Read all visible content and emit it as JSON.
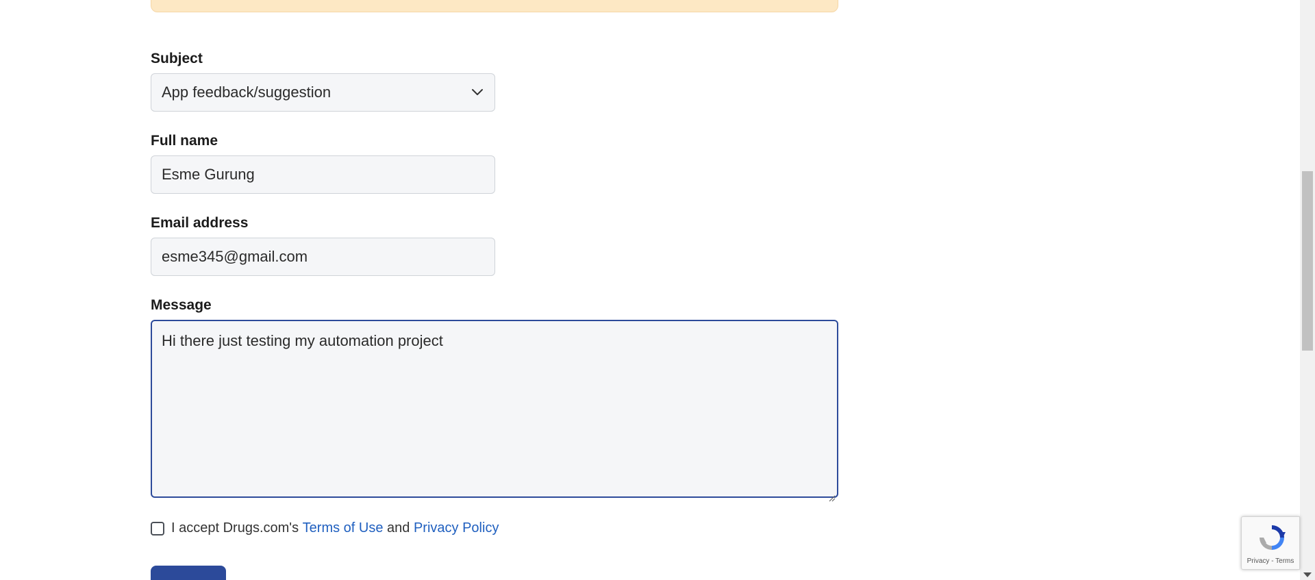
{
  "form": {
    "subject": {
      "label": "Subject",
      "selected": "App feedback/suggestion"
    },
    "full_name": {
      "label": "Full name",
      "value": "Esme Gurung"
    },
    "email": {
      "label": "Email address",
      "value": "esme345@gmail.com"
    },
    "message": {
      "label": "Message",
      "value": "Hi there just testing my automation project"
    },
    "accept": {
      "prefix": "I accept Drugs.com's ",
      "terms_link": "Terms of Use",
      "and": " and ",
      "privacy_link": "Privacy Policy"
    }
  },
  "recaptcha": {
    "privacy": "Privacy",
    "separator": " - ",
    "terms": "Terms"
  },
  "colors": {
    "accent": "#2c4a9a",
    "link": "#1f5fbf",
    "notice_bg": "#fde8c4",
    "field_bg": "#f5f6f8"
  },
  "icons": {
    "subject_dropdown": "chevron-down-icon",
    "recaptcha": "recaptcha-logo-icon"
  }
}
